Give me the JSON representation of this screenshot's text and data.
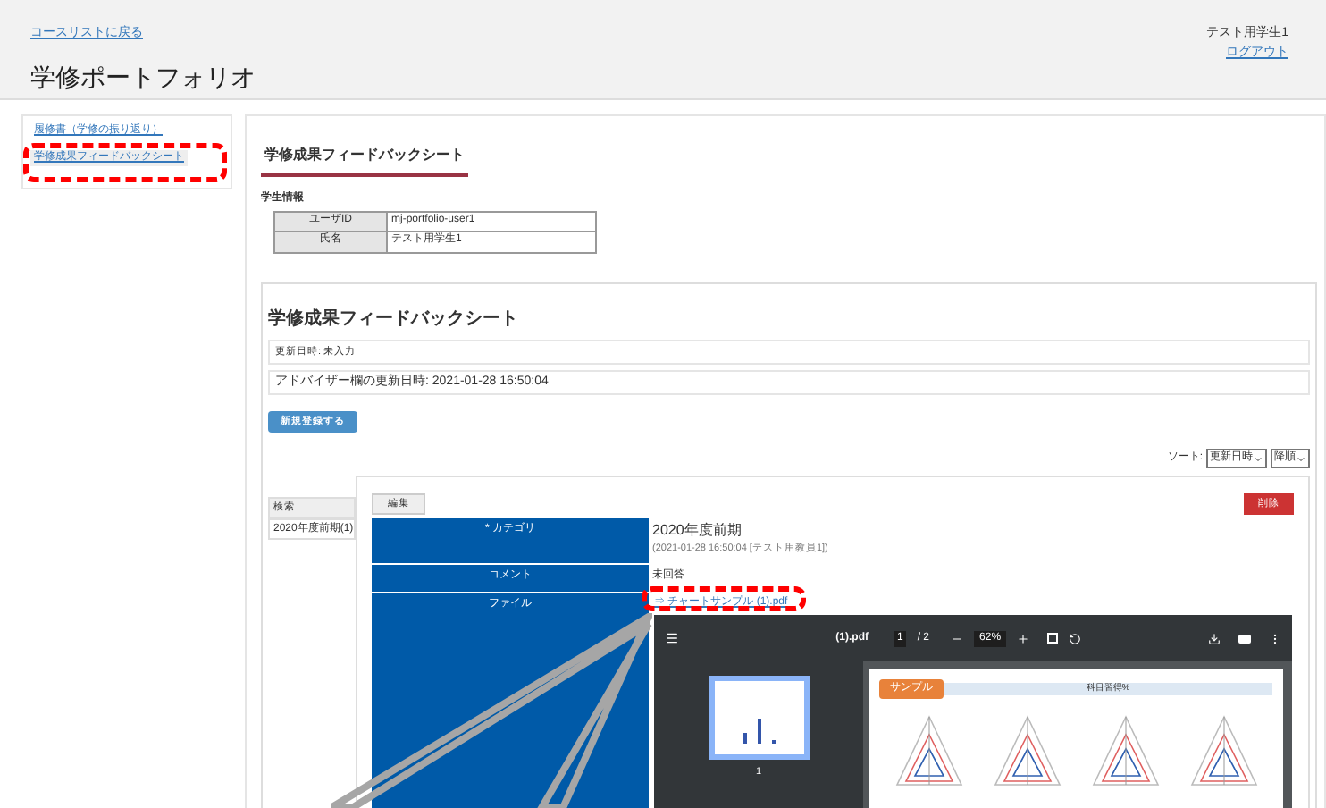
{
  "header": {
    "back_link": "コースリストに戻る",
    "title": "学修ポートフォリオ",
    "user": "テスト用学生1",
    "logout": "ログアウト"
  },
  "sidebar": {
    "items": [
      {
        "label": "履修書（学修の振り返り）",
        "selected": false
      },
      {
        "label": "学修成果フィードバックシート",
        "selected": true
      }
    ]
  },
  "page_tab": "学修成果フィードバックシート",
  "student_info": {
    "heading": "学生情報",
    "rows": [
      {
        "label": "ユーザID",
        "value": "mj-portfolio-user1"
      },
      {
        "label": "氏名",
        "value": "テスト用学生1"
      }
    ]
  },
  "sheet": {
    "title": "学修成果フィードバックシート",
    "updated": "更新日時: 未入力",
    "advisor_updated": "アドバイザー欄の更新日時: 2021-01-28 16:50:04",
    "new_button": "新規登録する",
    "sort_label": "ソート:",
    "sort_field": "更新日時",
    "sort_order": "降順",
    "list": {
      "heading": "検索",
      "items": [
        {
          "label": "2020年度前期(1)",
          "selected": true
        }
      ]
    },
    "detail": {
      "edit_tab": "編集",
      "delete_button": "削除",
      "rows": [
        {
          "kind": "category",
          "label": "* カテゴリ",
          "value": "2020年度前期",
          "sub": "(2021-01-28 16:50:04 [テスト用教員1])"
        },
        {
          "kind": "text",
          "label": "コメント",
          "value": "未回答"
        },
        {
          "kind": "file",
          "label": "ファイル",
          "value": "⇒ チャートサンプル (1).pdf"
        }
      ],
      "viewer": {
        "file_name": "(1).pdf",
        "page": "1",
        "pages": "/ 2",
        "zoom": "62%",
        "thumb_number": "1",
        "badge": "サンプル",
        "sheet_title": "科目習得%"
      }
    }
  },
  "annotations": [
    {
      "kind": "dashed-box",
      "color": "#ff0000"
    },
    {
      "kind": "dashed-box",
      "color": "#ff0000"
    },
    {
      "kind": "callout",
      "color": "#a6a6a6"
    }
  ]
}
